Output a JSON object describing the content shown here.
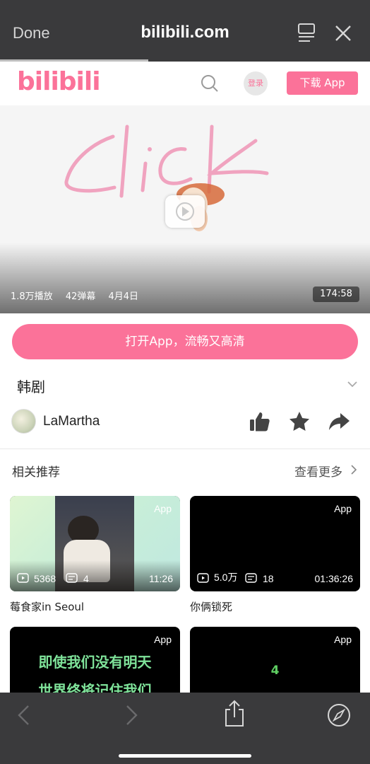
{
  "browser": {
    "done_label": "Done",
    "url_title": "bilibili.com"
  },
  "site": {
    "logo_text": "bilibili",
    "login_label": "登录",
    "download_label": "下载 App"
  },
  "video": {
    "overlay_text": "click",
    "plays": "1.8万播放",
    "danmaku": "42弹幕",
    "date": "4月4日",
    "duration": "174:58"
  },
  "open_app_label": "打开App，流畅又高清",
  "video_title": "韩剧",
  "author": {
    "name": "LaMartha"
  },
  "related": {
    "title": "相关推荐",
    "more_label": "查看更多",
    "cards": [
      {
        "app_label": "App",
        "plays": "5368",
        "danmaku": "4",
        "duration": "11:26",
        "title": "莓食家in Seoul"
      },
      {
        "app_label": "App",
        "plays": "5.0万",
        "danmaku": "18",
        "duration": "01:36:26",
        "title": "你俩锁死"
      },
      {
        "app_label": "App",
        "line1": "即使我们没有明天",
        "line2": "世界终将记住我们"
      },
      {
        "app_label": "App",
        "center_text": "4"
      }
    ]
  },
  "colors": {
    "brand_pink": "#fb7299",
    "toolbar_bg": "#3a3a3c"
  }
}
